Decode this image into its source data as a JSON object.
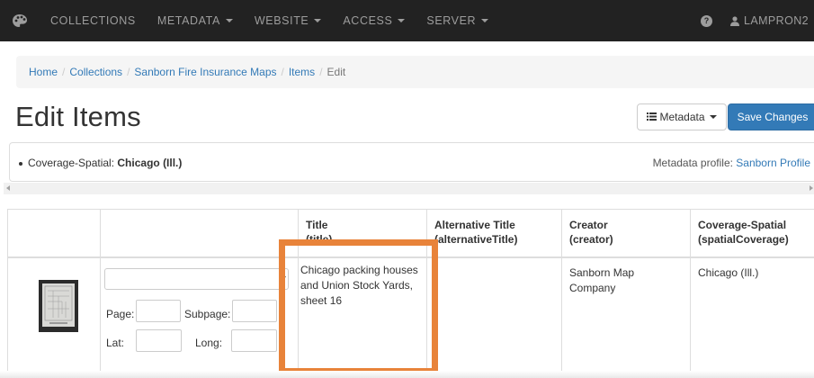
{
  "navbar": {
    "logo_icon": "palette-icon",
    "items": [
      {
        "label": "COLLECTIONS",
        "dropdown": false
      },
      {
        "label": "METADATA",
        "dropdown": true
      },
      {
        "label": "WEBSITE",
        "dropdown": true
      },
      {
        "label": "ACCESS",
        "dropdown": true
      },
      {
        "label": "SERVER",
        "dropdown": true
      }
    ],
    "help_icon": "question-circle-icon",
    "user_icon": "user-icon",
    "user_label": "LAMPRON2"
  },
  "breadcrumb": [
    "Home",
    "Collections",
    "Sanborn Fire Insurance Maps",
    "Items",
    "Edit"
  ],
  "page": {
    "title": "Edit Items",
    "metadata_button": "Metadata",
    "save_button": "Save Changes"
  },
  "info": {
    "field_label": "Coverage-Spatial: ",
    "field_value": "Chicago (Ill.)",
    "profile_label": "Metadata profile: ",
    "profile_link": "Sanborn Profile"
  },
  "table": {
    "headers": [
      {
        "label": "",
        "sub": ""
      },
      {
        "label": "",
        "sub": ""
      },
      {
        "label": "Title",
        "sub": "(title)"
      },
      {
        "label": "Alternative Title",
        "sub": "(alternativeTitle)"
      },
      {
        "label": "Creator",
        "sub": "(creator)"
      },
      {
        "label": "Coverage-Spatial",
        "sub": "(spatialCoverage)"
      }
    ],
    "row": {
      "title": "Chicago packing houses and Union Stock Yards, sheet 16",
      "alternative_title": "",
      "creator": "Sanborn Map Company",
      "coverage_spatial": "Chicago (Ill.)",
      "select_value": "",
      "page_label": "Page:",
      "subpage_label": "Subpage:",
      "lat_label": "Lat:",
      "long_label": "Long:"
    }
  },
  "colors": {
    "navbar_bg": "#222222",
    "link": "#337ab7",
    "primary_button": "#337ab7",
    "highlight": "#e8833a"
  }
}
